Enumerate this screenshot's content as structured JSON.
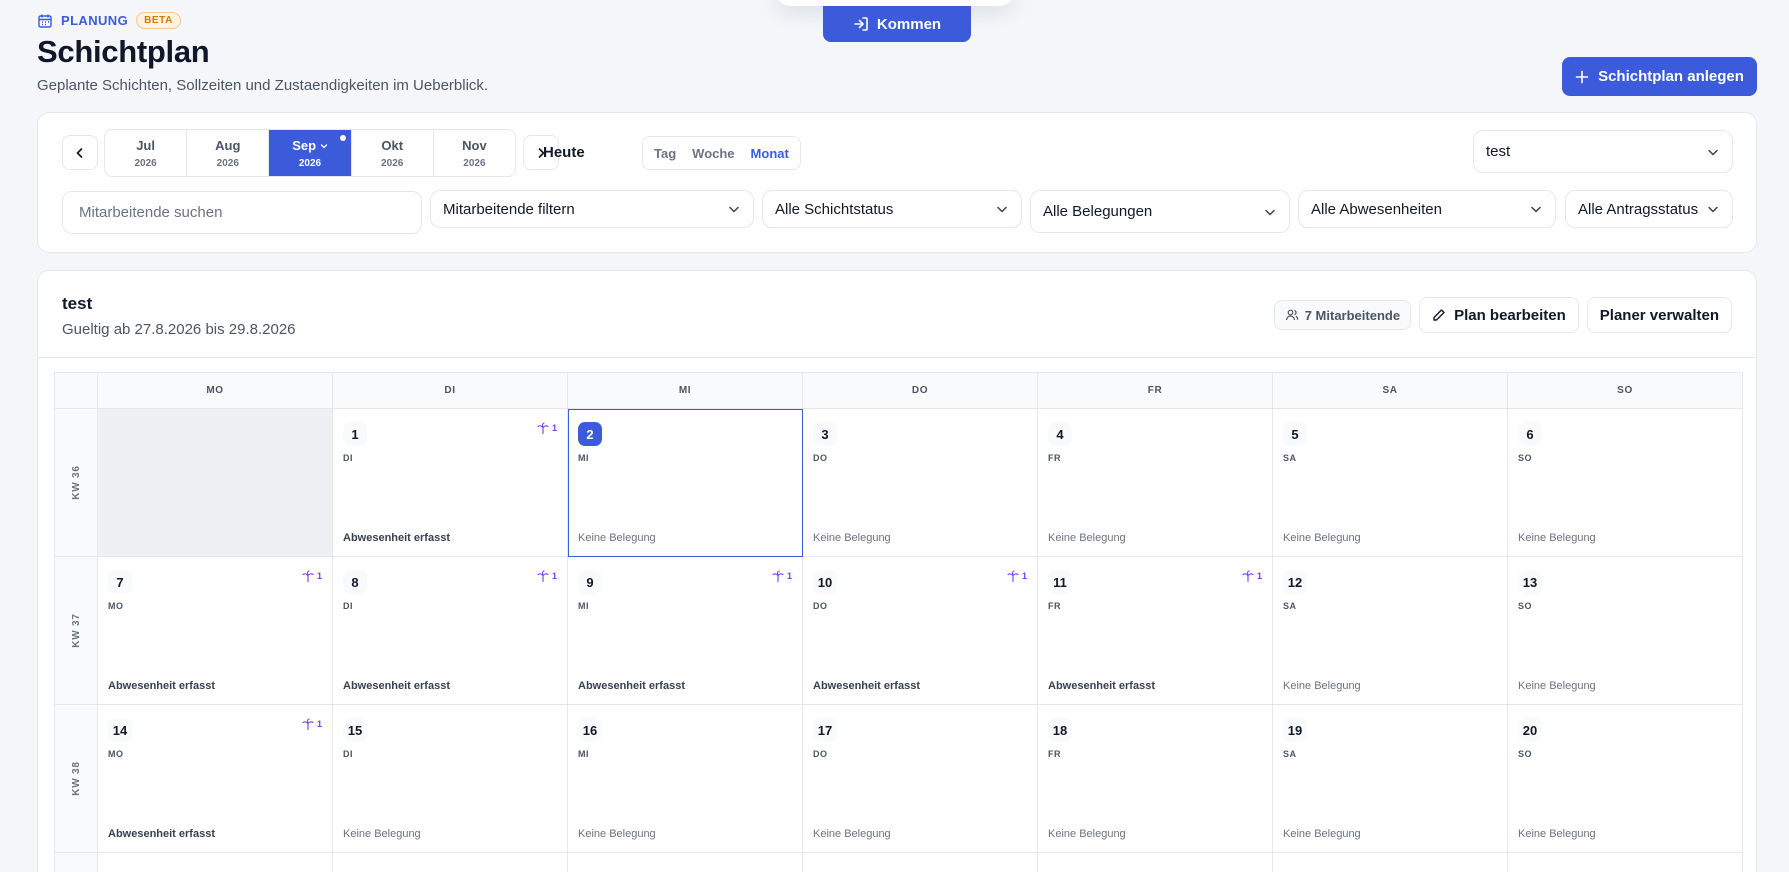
{
  "topbar": {
    "kommen_label": "Kommen"
  },
  "header": {
    "eyebrow": "PLANUNG",
    "beta": "BETA",
    "title": "Schichtplan",
    "subtitle": "Geplante Schichten, Sollzeiten und Zustaendigkeiten im Ueberblick.",
    "create_label": "Schichtplan anlegen"
  },
  "toolbar": {
    "months": [
      {
        "month": "Jul",
        "year": "2026"
      },
      {
        "month": "Aug",
        "year": "2026"
      },
      {
        "month": "Sep",
        "year": "2026"
      },
      {
        "month": "Okt",
        "year": "2026"
      },
      {
        "month": "Nov",
        "year": "2026"
      }
    ],
    "today_label": "Heute",
    "views": [
      "Tag",
      "Woche",
      "Monat"
    ],
    "plan_select": "test"
  },
  "filters": {
    "search_placeholder": "Mitarbeitende suchen",
    "employees": "Mitarbeitende filtern",
    "shift_status": "Alle Schichtstatus",
    "assignments": "Alle Belegungen",
    "absences": "Alle Abwesenheiten",
    "request_status": "Alle Antragsstatus"
  },
  "plan": {
    "title": "test",
    "valid": "Gueltig ab 27.8.2026 bis 29.8.2026",
    "members": "7 Mitarbeitende",
    "edit_label": "Plan bearbeiten",
    "manage_label": "Planer verwalten"
  },
  "calendar": {
    "weekdays": [
      "MO",
      "DI",
      "MI",
      "DO",
      "FR",
      "SA",
      "SO"
    ],
    "weeks": [
      {
        "kw": "KW 36",
        "days": [
          null,
          {
            "num": "1",
            "wd": "DI",
            "status": "Abwesenheit erfasst",
            "absence": "1"
          },
          {
            "num": "2",
            "wd": "MI",
            "status": "Keine Belegung",
            "today": true
          },
          {
            "num": "3",
            "wd": "DO",
            "status": "Keine Belegung"
          },
          {
            "num": "4",
            "wd": "FR",
            "status": "Keine Belegung"
          },
          {
            "num": "5",
            "wd": "SA",
            "status": "Keine Belegung"
          },
          {
            "num": "6",
            "wd": "SO",
            "status": "Keine Belegung"
          }
        ]
      },
      {
        "kw": "KW 37",
        "days": [
          {
            "num": "7",
            "wd": "MO",
            "status": "Abwesenheit erfasst",
            "absence": "1"
          },
          {
            "num": "8",
            "wd": "DI",
            "status": "Abwesenheit erfasst",
            "absence": "1"
          },
          {
            "num": "9",
            "wd": "MI",
            "status": "Abwesenheit erfasst",
            "absence": "1"
          },
          {
            "num": "10",
            "wd": "DO",
            "status": "Abwesenheit erfasst",
            "absence": "1"
          },
          {
            "num": "11",
            "wd": "FR",
            "status": "Abwesenheit erfasst",
            "absence": "1"
          },
          {
            "num": "12",
            "wd": "SA",
            "status": "Keine Belegung"
          },
          {
            "num": "13",
            "wd": "SO",
            "status": "Keine Belegung"
          }
        ]
      },
      {
        "kw": "KW 38",
        "days": [
          {
            "num": "14",
            "wd": "MO",
            "status": "Abwesenheit erfasst",
            "absence": "1"
          },
          {
            "num": "15",
            "wd": "DI",
            "status": "Keine Belegung"
          },
          {
            "num": "16",
            "wd": "MI",
            "status": "Keine Belegung"
          },
          {
            "num": "17",
            "wd": "DO",
            "status": "Keine Belegung"
          },
          {
            "num": "18",
            "wd": "FR",
            "status": "Keine Belegung"
          },
          {
            "num": "19",
            "wd": "SA",
            "status": "Keine Belegung"
          },
          {
            "num": "20",
            "wd": "SO",
            "status": "Keine Belegung"
          }
        ]
      }
    ]
  }
}
